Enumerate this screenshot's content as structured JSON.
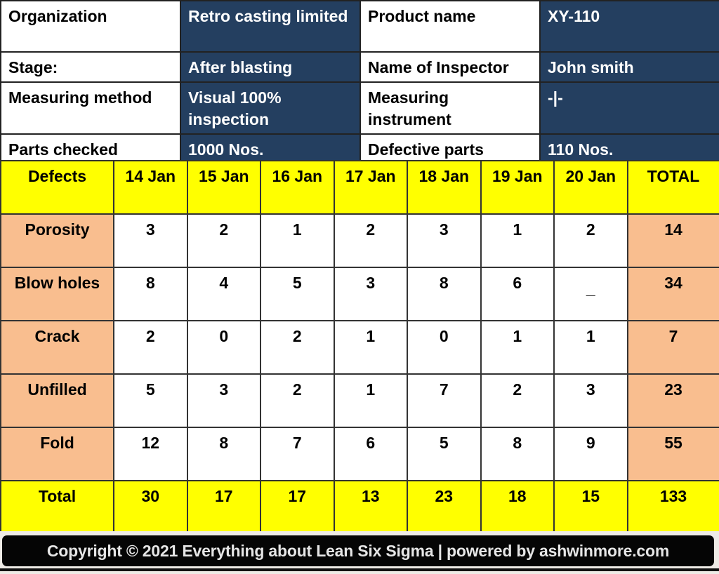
{
  "info": {
    "organization_label": "Organization",
    "organization_value": "Retro casting limited",
    "product_name_label": "Product name",
    "product_name_value": "XY-110",
    "stage_label": "Stage:",
    "stage_value": "After blasting",
    "inspector_label": "Name of Inspector",
    "inspector_value": "John smith",
    "method_label": "Measuring method",
    "method_value": "Visual 100% inspection",
    "instrument_label": "Measuring instrument",
    "instrument_value": "-|-",
    "parts_checked_label": "Parts checked",
    "parts_checked_value": "1000 Nos.",
    "defective_parts_label": "Defective parts",
    "defective_parts_value": "110 Nos."
  },
  "table": {
    "headers": [
      "Defects",
      "14 Jan",
      "15 Jan",
      "16 Jan",
      "17 Jan",
      "18 Jan",
      "19 Jan",
      "20 Jan",
      "TOTAL"
    ],
    "rows": [
      {
        "defect": "Porosity",
        "values": [
          "3",
          "2",
          "1",
          "2",
          "3",
          "1",
          "2"
        ],
        "total": "14"
      },
      {
        "defect": "Blow holes",
        "values": [
          "8",
          "4",
          "5",
          "3",
          "8",
          "6",
          "_"
        ],
        "total": "34"
      },
      {
        "defect": "Crack",
        "values": [
          "2",
          "0",
          "2",
          "1",
          "0",
          "1",
          "1"
        ],
        "total": "7"
      },
      {
        "defect": "Unfilled",
        "values": [
          "5",
          "3",
          "2",
          "1",
          "7",
          "2",
          "3"
        ],
        "total": "23"
      },
      {
        "defect": "Fold",
        "values": [
          "12",
          "8",
          "7",
          "6",
          "5",
          "8",
          "9"
        ],
        "total": "55"
      }
    ],
    "total_row": {
      "label": "Total",
      "values": [
        "30",
        "17",
        "17",
        "13",
        "23",
        "18",
        "15"
      ],
      "total": "133"
    }
  },
  "colors": {
    "value_cell_bg": "#243f60",
    "header_yellow": "#ffff00",
    "row_label_peach": "#f9be8f"
  },
  "footer": {
    "text": "Copyright © 2021 Everything about Lean Six Sigma | powered by ashwinmore.com"
  }
}
